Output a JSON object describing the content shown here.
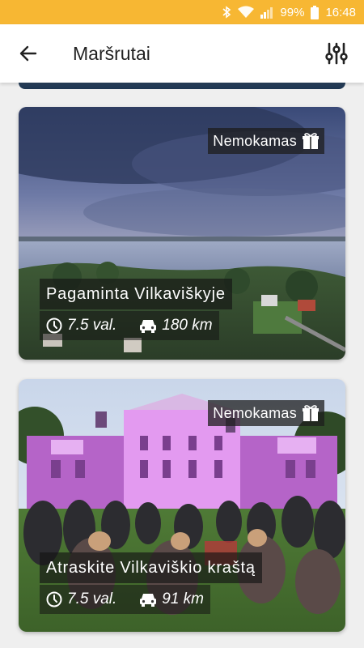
{
  "status_bar": {
    "battery": "99%",
    "time": "16:48",
    "icons": [
      "bluetooth-icon",
      "wifi-icon",
      "signal-icon",
      "battery-icon"
    ]
  },
  "app_bar": {
    "title": "Maršrutai",
    "back_icon": "arrow-back-icon",
    "filter_icon": "sliders-icon"
  },
  "routes": [
    {
      "badge": "Nemokamas",
      "badge_icon": "gift-icon",
      "name": "Pagaminta Vilkaviškyje",
      "duration": "7.5 val.",
      "distance": "180 km"
    },
    {
      "badge": "Nemokamas",
      "badge_icon": "gift-icon",
      "name": "Atraskite Vilkaviškio kraštą",
      "duration": "7.5 val.",
      "distance": "91 km"
    }
  ],
  "colors": {
    "status_bar": "#f7b733",
    "app_bar": "#ffffff",
    "background": "#efefef"
  }
}
